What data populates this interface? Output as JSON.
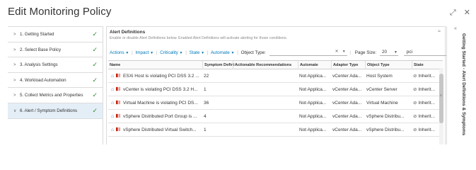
{
  "window": {
    "title": "Edit Monitoring Policy",
    "expand_icon": "⤢",
    "close_icon": "✕"
  },
  "steps": [
    {
      "label": "1. Getting Started",
      "chevron": ">",
      "check": "✓"
    },
    {
      "label": "2. Select Base Policy",
      "chevron": ">",
      "check": "✓"
    },
    {
      "label": "3. Analysis Settings",
      "chevron": ">",
      "check": "✓"
    },
    {
      "label": "4. Workload Automation",
      "chevron": ">",
      "check": "✓"
    },
    {
      "label": "5. Collect Metrics and Properties",
      "chevron": ">",
      "check": "✓"
    },
    {
      "label": "6. Alert / Symptom Definitions",
      "chevron": "∨",
      "check": "✓"
    }
  ],
  "alert_definitions": {
    "title": "Alert Definitions",
    "description": "Enable or disable Alert Definitions below. Enabled Alert Definitions will activate alerting for those conditions.",
    "collapse_icon": "≈"
  },
  "toolbar": {
    "actions": "Actions",
    "impact": "Impact",
    "criticality": "Criticality",
    "state": "State",
    "automate": "Automate",
    "object_type_label": "Object Type:",
    "clear_icon": "✕",
    "page_size_label": "Page Size:",
    "page_size_value": "20",
    "search_value": "pci"
  },
  "columns": {
    "name": "Name",
    "symptom": "Symptom Defini",
    "actionable": "Actionable Recommendations",
    "automate": "Automate",
    "adapter": "Adapter Type",
    "object_type": "Object Type",
    "state": "State"
  },
  "rows": [
    {
      "name": "ESXi Host is violating PCI DSS 3.2 ...",
      "symptom": "22",
      "actionable": "",
      "automate": "Not Applica...",
      "adapter": "vCenter Ada...",
      "object_type": "Host System",
      "state": "Inherit..."
    },
    {
      "name": "vCenter is violating PCI DSS 3.2 H...",
      "symptom": "1",
      "actionable": "",
      "automate": "Not Applica...",
      "adapter": "vCenter Ada...",
      "object_type": "vCenter Server",
      "state": "Inherit..."
    },
    {
      "name": "Virtual Machine is violating PCI DS...",
      "symptom": "36",
      "actionable": "",
      "automate": "Not Applica...",
      "adapter": "vCenter Ada...",
      "object_type": "Virtual Machine",
      "state": "Inherit..."
    },
    {
      "name": "vSphere Distributed Port Group is ...",
      "symptom": "4",
      "actionable": "",
      "automate": "Not Applica...",
      "adapter": "vCenter Ada...",
      "object_type": "vSphere Distribu...",
      "state": "Inherit..."
    },
    {
      "name": "vSphere Distributed Virtual Switch...",
      "symptom": "1",
      "actionable": "",
      "automate": "Not Applica...",
      "adapter": "vCenter Ada...",
      "object_type": "vSphere Distribu...",
      "state": "Inherit..."
    }
  ],
  "side_panel": {
    "collapse_icon": "«",
    "label": "Getting Started - Alert Definitions & Symptoms"
  },
  "colors": {
    "accent": "#0079b8",
    "check": "#2e8b2e",
    "active_step_bg": "#e4eef6",
    "alert_red": "#c92100"
  }
}
